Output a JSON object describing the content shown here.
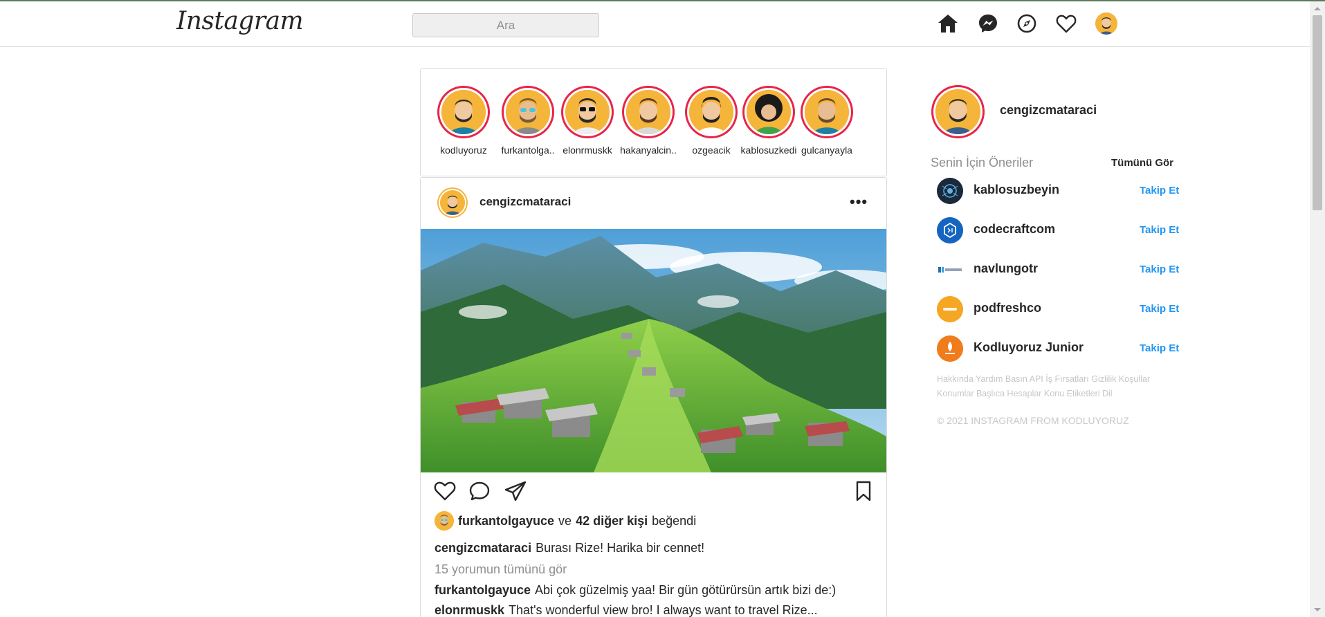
{
  "header": {
    "logo": "Instagram",
    "search_placeholder": "Ara"
  },
  "stories": [
    {
      "name": "kodluyoruz"
    },
    {
      "name": "furkantolga.."
    },
    {
      "name": "elonrmuskk"
    },
    {
      "name": "hakanyalcin.."
    },
    {
      "name": "ozgeacik"
    },
    {
      "name": "kablosuzkedi"
    },
    {
      "name": "gulcanyayla"
    }
  ],
  "post": {
    "username": "cengizcmataraci",
    "more": "•••",
    "likes": {
      "user": "furkantolgayuce",
      "joiner": "ve",
      "others": "42 diğer kişi",
      "suffix": "beğendi"
    },
    "caption": {
      "user": "cengizcmataraci",
      "text": "Burası Rize! Harika bir cennet!"
    },
    "view_all": "15 yorumun tümünü gör",
    "comments": [
      {
        "user": "furkantolgayuce",
        "text": "Abi çok güzelmiş yaa! Bir gün götürürsün artık bizi de:)"
      },
      {
        "user": "elonrmuskk",
        "text": "That's wonderful view bro! I always want to travel Rize..."
      }
    ]
  },
  "sidebar": {
    "me": "cengizcmataraci",
    "suggestions_title": "Senin İçin Öneriler",
    "see_all": "Tümünü Gör",
    "suggestions": [
      {
        "name": "kablosuzbeyin",
        "follow": "Takip Et",
        "color": "#1b2a3a"
      },
      {
        "name": "codecraftcom",
        "follow": "Takip Et",
        "color": "#1565c0"
      },
      {
        "name": "navlungotr",
        "follow": "Takip Et",
        "color": "#ffffff"
      },
      {
        "name": "podfreshco",
        "follow": "Takip Et",
        "color": "#f5a623"
      },
      {
        "name": "Kodluyoruz Junior",
        "follow": "Takip Et",
        "color": "#f07c1b"
      }
    ],
    "footer_links_1": "Hakkında Yardım Basın API İş Fırsatları Gizlilik Koşullar",
    "footer_links_2": "Konumlar Başlıca Hesaplar Konu Etiketleri Dil",
    "copyright": "© 2021 INSTAGRAM FROM KODLUYORUZ"
  },
  "colors": {
    "accent_blue": "#2196f3",
    "story_ring": "#e8244b",
    "avatar_bg": "#f5b43a"
  }
}
